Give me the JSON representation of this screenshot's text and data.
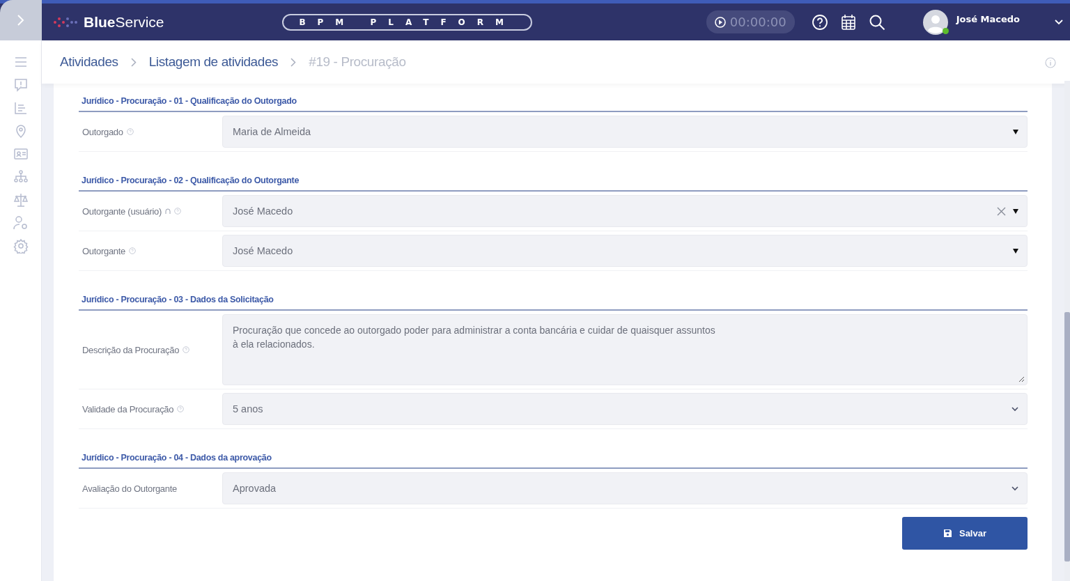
{
  "header": {
    "logo": "**Blue**Service",
    "platform": "BPM PLATFORM",
    "timer": "00:00:00",
    "user": {
      "name": "José Macedo",
      "online": true
    }
  },
  "breadcrumb": [
    {
      "label": "Atividades",
      "current": false
    },
    {
      "label": "Listagem de atividades",
      "current": false
    },
    {
      "label": "#19 - Procuração",
      "current": true
    }
  ],
  "sections": [
    {
      "title": "Jurídico - Procuração - 01 - Qualificação do Outorgado",
      "fields": [
        {
          "label": "Outorgado",
          "help": true,
          "locked": false,
          "kind": "combo",
          "clearable": false,
          "value": "Maria de Almeida"
        }
      ]
    },
    {
      "title": "Jurídico - Procuração - 02 - Qualificação do Outorgante",
      "fields": [
        {
          "label": "Outorgante (usuário)",
          "help": true,
          "locked": true,
          "kind": "combo",
          "clearable": true,
          "value": "José Macedo"
        },
        {
          "label": "Outorgante",
          "help": true,
          "locked": false,
          "kind": "combo",
          "clearable": false,
          "value": "José Macedo"
        }
      ]
    },
    {
      "title": "Jurídico - Procuração - 03 - Dados da Solicitação",
      "fields": [
        {
          "label": "Descrição da Procuração",
          "help": true,
          "locked": false,
          "kind": "textarea",
          "clearable": false,
          "value": "Procuração que concede ao outorgado poder para administrar a conta bancária e cuidar de quaisquer assuntos\nà ela relacionados."
        },
        {
          "label": "Validade da Procuração",
          "help": true,
          "locked": false,
          "kind": "select",
          "clearable": false,
          "value": "5 anos"
        }
      ]
    },
    {
      "title": "Jurídico - Procuração - 04 - Dados da aprovação",
      "fields": [
        {
          "label": "Avaliação do Outorgante",
          "help": false,
          "locked": false,
          "kind": "select",
          "clearable": false,
          "value": "Aprovada"
        }
      ]
    }
  ],
  "save_button": "Salvar"
}
